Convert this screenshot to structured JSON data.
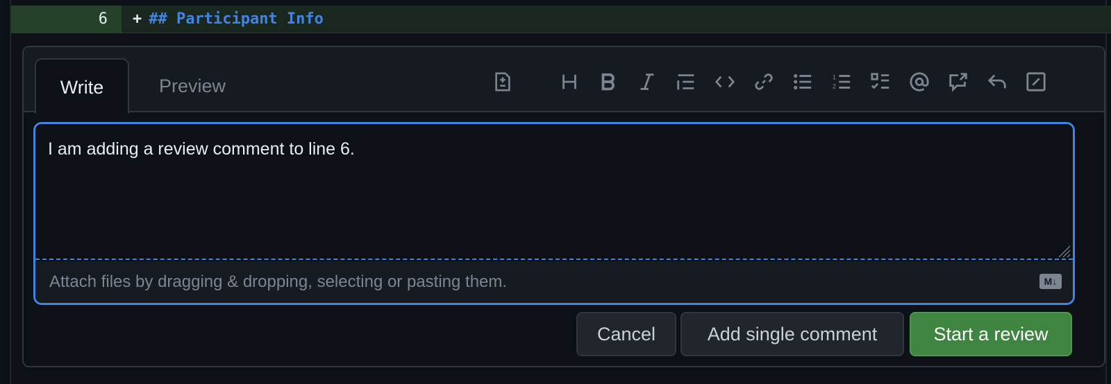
{
  "diff": {
    "line_number": "6",
    "marker": "+",
    "code": "## Participant Info"
  },
  "tabs": [
    {
      "label": "Write",
      "active": true
    },
    {
      "label": "Preview",
      "active": false
    }
  ],
  "toolbar": [
    {
      "name": "add-suggestion",
      "icon": "file-diff-icon"
    },
    {
      "name": "heading",
      "icon": "heading-icon"
    },
    {
      "name": "bold",
      "icon": "bold-icon"
    },
    {
      "name": "italic",
      "icon": "italic-icon"
    },
    {
      "name": "quote",
      "icon": "quote-icon"
    },
    {
      "name": "code",
      "icon": "code-icon"
    },
    {
      "name": "link",
      "icon": "link-icon"
    },
    {
      "name": "unordered-list",
      "icon": "list-unordered-icon"
    },
    {
      "name": "ordered-list",
      "icon": "list-ordered-icon"
    },
    {
      "name": "task-list",
      "icon": "tasklist-icon"
    },
    {
      "name": "mention",
      "icon": "mention-icon"
    },
    {
      "name": "cross-reference",
      "icon": "cross-reference-icon"
    },
    {
      "name": "saved-replies",
      "icon": "reply-icon"
    },
    {
      "name": "slash-commands",
      "icon": "slash-icon"
    }
  ],
  "editor": {
    "value": "I am adding a review comment to line 6.",
    "attach_hint": "Attach files by dragging & dropping, selecting or pasting them.",
    "markdown_badge": "M↓"
  },
  "actions": {
    "cancel": "Cancel",
    "single": "Add single comment",
    "review": "Start a review"
  },
  "colors": {
    "accent": "#4184e4",
    "primary_button": "#3f8440",
    "added_line_bg": "#19271f"
  }
}
